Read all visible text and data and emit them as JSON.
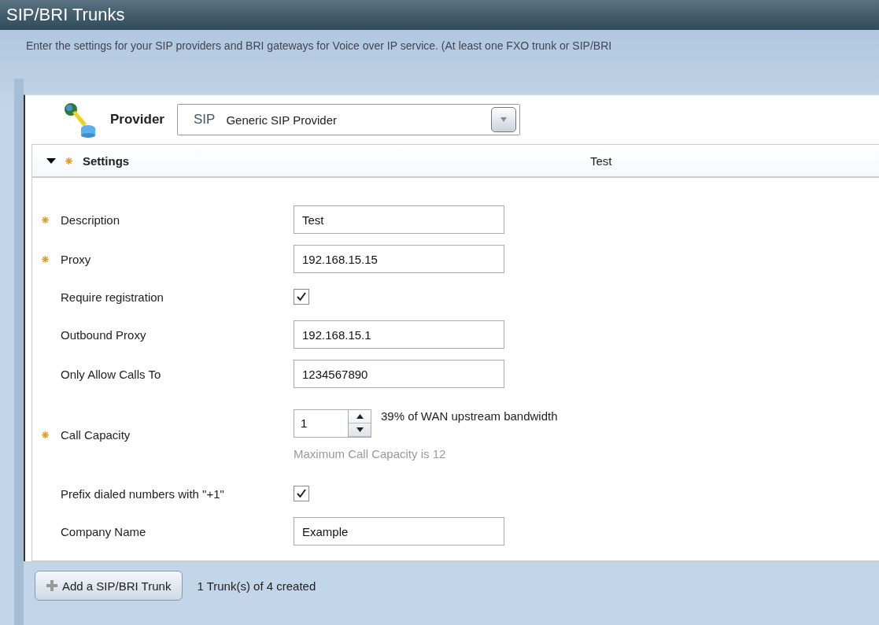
{
  "header": {
    "title": "SIP/BRI Trunks",
    "description": "Enter the settings for your SIP providers and BRI gateways for Voice over IP service. (At least one FXO trunk or SIP/BRI"
  },
  "provider": {
    "label": "Provider",
    "type_tag": "SIP",
    "value": "Generic SIP Provider"
  },
  "settings": {
    "title": "Settings",
    "expanded": true,
    "required": true,
    "summary": "Test",
    "rows": [
      {
        "kind": "text",
        "label": "Description",
        "required": true,
        "value": "Test"
      },
      {
        "kind": "text",
        "label": "Proxy",
        "required": true,
        "value": "192.168.15.15"
      },
      {
        "kind": "checkbox",
        "label": "Require registration",
        "required": false,
        "checked": true
      },
      {
        "kind": "text",
        "label": "Outbound Proxy",
        "required": false,
        "value": "192.168.15.1"
      },
      {
        "kind": "text",
        "label": "Only Allow Calls To",
        "required": false,
        "value": "1234567890"
      },
      {
        "kind": "spinner",
        "label": "Call Capacity",
        "required": true,
        "value": "1",
        "note": "39% of WAN upstream bandwidth",
        "hint": "Maximum Call Capacity is 12"
      },
      {
        "kind": "checkbox",
        "label": "Prefix dialed numbers with \"+1\"",
        "required": false,
        "checked": true
      },
      {
        "kind": "text",
        "label": "Company Name",
        "required": false,
        "value": "Example"
      }
    ]
  },
  "footer": {
    "add_button": "Add a SIP/BRI Trunk",
    "status": "1 Trunk(s) of 4 created"
  }
}
